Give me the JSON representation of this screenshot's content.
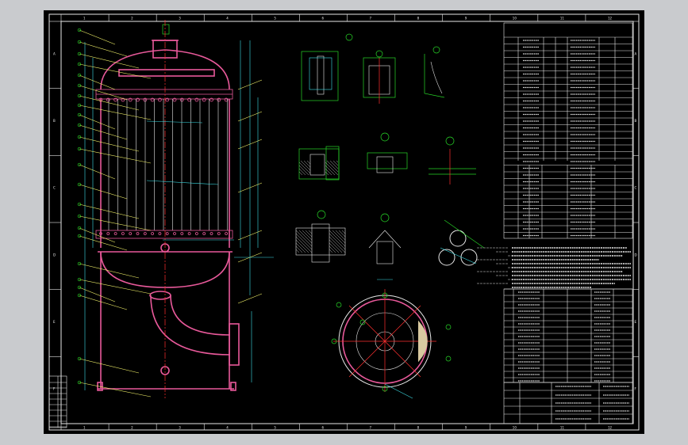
{
  "sheet": {
    "border_numbers_top": [
      "1",
      "2",
      "3",
      "4",
      "5",
      "6",
      "7",
      "8",
      "9",
      "10",
      "11",
      "12"
    ],
    "border_numbers_bottom": [
      "1",
      "2",
      "3",
      "4",
      "5",
      "6",
      "7",
      "8",
      "9",
      "10",
      "11",
      "12"
    ],
    "border_letters": [
      "A",
      "B",
      "C",
      "D",
      "E",
      "F"
    ]
  },
  "colors": {
    "background": "#000000",
    "frame": "#e8e8e8",
    "vessel": "#e8599a",
    "dimension": "#3de0e8",
    "leader": "#f4f46a",
    "balloon": "#27d627",
    "centerline": "#ff3030"
  },
  "icons": {
    "vessel": "pressure-vessel-elevation",
    "plan": "circular-plan-view",
    "details": "nozzle-flange-detail"
  }
}
